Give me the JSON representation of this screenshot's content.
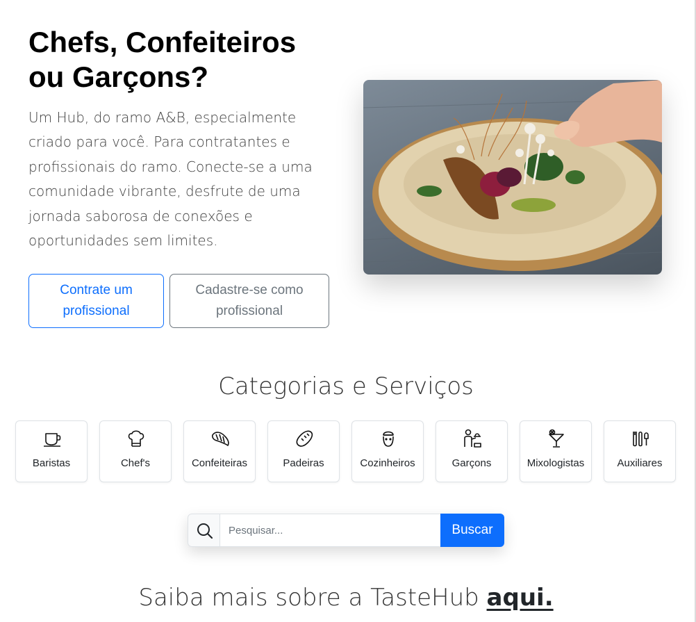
{
  "hero": {
    "title": "Chefs, Confeiteiros ou Garçons?",
    "description": "Um Hub, do ramo A&B, especialmente criado para você. Para contratantes e profissionais do ramo. Conecte-se a uma comunidade vibrante, desfrute de uma jornada saborosa de conexões e oportunidades sem limites.",
    "primary_button": "Contrate um profissional",
    "secondary_button": "Cadastre-se como profissional",
    "image_icon": "plated-dish-photo"
  },
  "categories": {
    "title": "Categorias e Serviços",
    "items": [
      {
        "label": "Baristas",
        "icon": "coffee-cup-icon"
      },
      {
        "label": "Chef's",
        "icon": "chef-hat-icon"
      },
      {
        "label": "Confeiteiras",
        "icon": "croissant-icon"
      },
      {
        "label": "Padeiras",
        "icon": "bread-icon"
      },
      {
        "label": "Cozinheiros",
        "icon": "cook-icon"
      },
      {
        "label": "Garçons",
        "icon": "waiter-icon"
      },
      {
        "label": "Mixologistas",
        "icon": "cocktail-icon"
      },
      {
        "label": "Auxiliares",
        "icon": "helpers-icon"
      }
    ]
  },
  "search": {
    "placeholder": "Pesquisar...",
    "button": "Buscar",
    "icon": "search-icon"
  },
  "about": {
    "prefix": "Saiba mais sobre a TasteHub ",
    "link": "aqui."
  },
  "colors": {
    "primary": "#0d6efd",
    "secondary": "#6c757d",
    "text": "#212529"
  }
}
